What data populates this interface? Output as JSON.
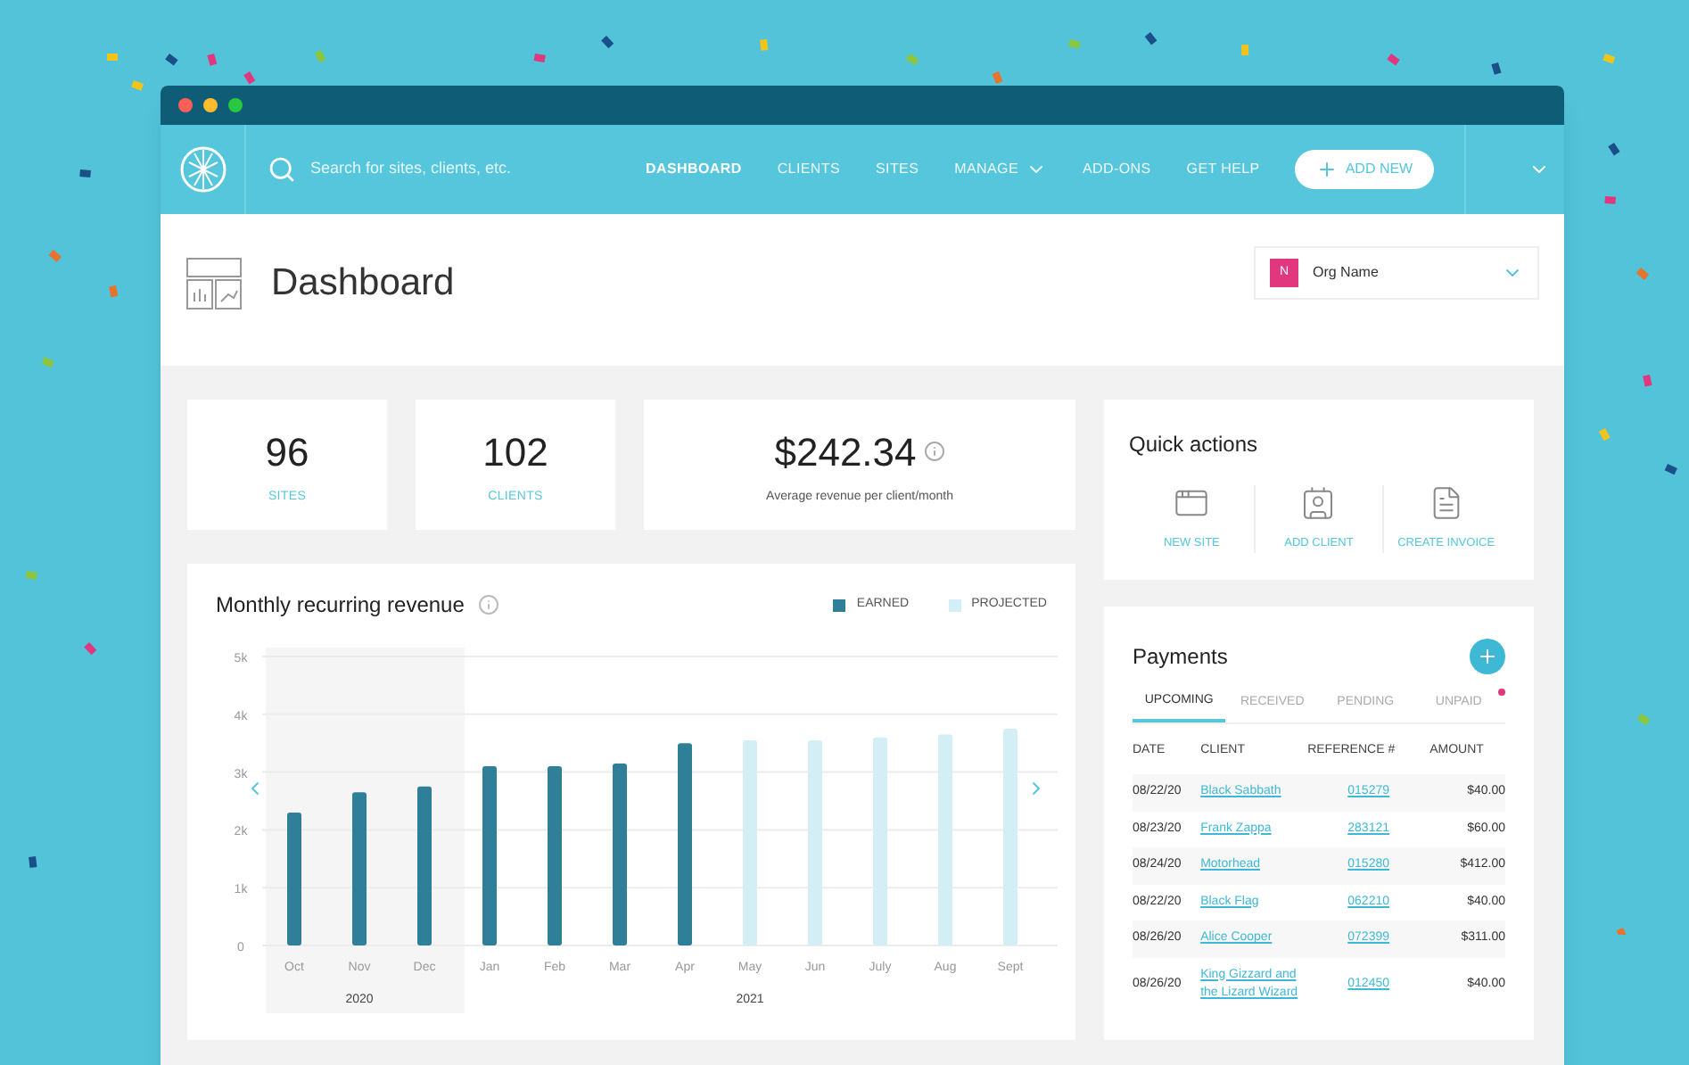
{
  "window": {
    "controls": [
      {
        "color": "#ff5f57"
      },
      {
        "color": "#febc2e"
      },
      {
        "color": "#28c840"
      }
    ]
  },
  "nav": {
    "search": {
      "placeholder": "Search for sites, clients, etc."
    },
    "items": [
      {
        "label": "DASHBOARD",
        "selected": true,
        "has_menu": false
      },
      {
        "label": "CLIENTS",
        "selected": false,
        "has_menu": false
      },
      {
        "label": "SITES",
        "selected": false,
        "has_menu": false
      },
      {
        "label": "MANAGE",
        "selected": false,
        "has_menu": true
      },
      {
        "label": "ADD-ONS",
        "selected": false,
        "has_menu": false
      },
      {
        "label": "GET HELP",
        "selected": false,
        "has_menu": false
      }
    ],
    "add_button": "ADD NEW"
  },
  "header": {
    "title": "Dashboard",
    "org": {
      "initial": "N",
      "name": "Org Name",
      "color": "#e0377f"
    }
  },
  "stats": [
    {
      "value": "96",
      "label": "SITES",
      "kind": "count"
    },
    {
      "value": "102",
      "label": "CLIENTS",
      "kind": "count"
    },
    {
      "value": "$242.34",
      "label": "Average revenue per client/month",
      "kind": "info"
    }
  ],
  "quick_actions": {
    "title": "Quick actions",
    "items": [
      {
        "label": "NEW SITE",
        "kind": "site"
      },
      {
        "label": "ADD CLIENT",
        "kind": "client"
      },
      {
        "label": "CREATE INVOICE",
        "kind": "invoice"
      }
    ]
  },
  "revenue": {
    "title": "Monthly recurring revenue",
    "years": [
      {
        "label": "2020",
        "shaded": true
      },
      {
        "label": "2021",
        "shaded": false
      }
    ],
    "chart_data": {
      "type": "bar",
      "stacked": true,
      "grid": true,
      "categories": [
        "Oct",
        "Nov",
        "Dec",
        "Jan",
        "Feb",
        "Mar",
        "Apr",
        "May",
        "Jun",
        "July",
        "Aug",
        "Sept"
      ],
      "series": [
        {
          "name": "EARNED",
          "color": "#2f7f99",
          "values": [
            2.3,
            2.65,
            2.75,
            3.1,
            3.1,
            3.15,
            3.5,
            null,
            null,
            null,
            null,
            null
          ]
        },
        {
          "name": "PROJECTED",
          "color": "#d3eef4",
          "values": [
            null,
            null,
            null,
            null,
            null,
            null,
            null,
            3.55,
            3.55,
            3.6,
            3.65,
            3.75
          ]
        }
      ],
      "ylim": [
        0,
        5
      ],
      "yticks": [
        {
          "value": 0,
          "label": "0"
        },
        {
          "value": 1,
          "label": "1k"
        },
        {
          "value": 2,
          "label": "2k"
        },
        {
          "value": 3,
          "label": "3k"
        },
        {
          "value": 4,
          "label": "4k"
        },
        {
          "value": 5,
          "label": "5k"
        }
      ]
    }
  },
  "payments": {
    "title": "Payments",
    "tabs": [
      {
        "label": "UPCOMING",
        "selected": true,
        "alert": false
      },
      {
        "label": "RECEIVED",
        "selected": false,
        "alert": false
      },
      {
        "label": "PENDING",
        "selected": false,
        "alert": false
      },
      {
        "label": "UNPAID",
        "selected": false,
        "alert": true
      }
    ],
    "columns": [
      "DATE",
      "CLIENT",
      "REFERENCE #",
      "AMOUNT"
    ],
    "rows": [
      {
        "date": "08/22/20",
        "client": "Black Sabbath",
        "reference": "015279",
        "amount": "$40.00"
      },
      {
        "date": "08/23/20",
        "client": "Frank Zappa",
        "reference": "283121",
        "amount": "$60.00"
      },
      {
        "date": "08/24/20",
        "client": "Motorhead",
        "reference": "015280",
        "amount": "$412.00"
      },
      {
        "date": "08/22/20",
        "client": "Black Flag",
        "reference": "062210",
        "amount": "$40.00"
      },
      {
        "date": "08/26/20",
        "client": "Alice Cooper",
        "reference": "072399",
        "amount": "$311.00"
      },
      {
        "date": "08/26/20",
        "client": "King Gizzard and the Lizard Wizard",
        "reference": "012450",
        "amount": "$40.00"
      }
    ]
  }
}
